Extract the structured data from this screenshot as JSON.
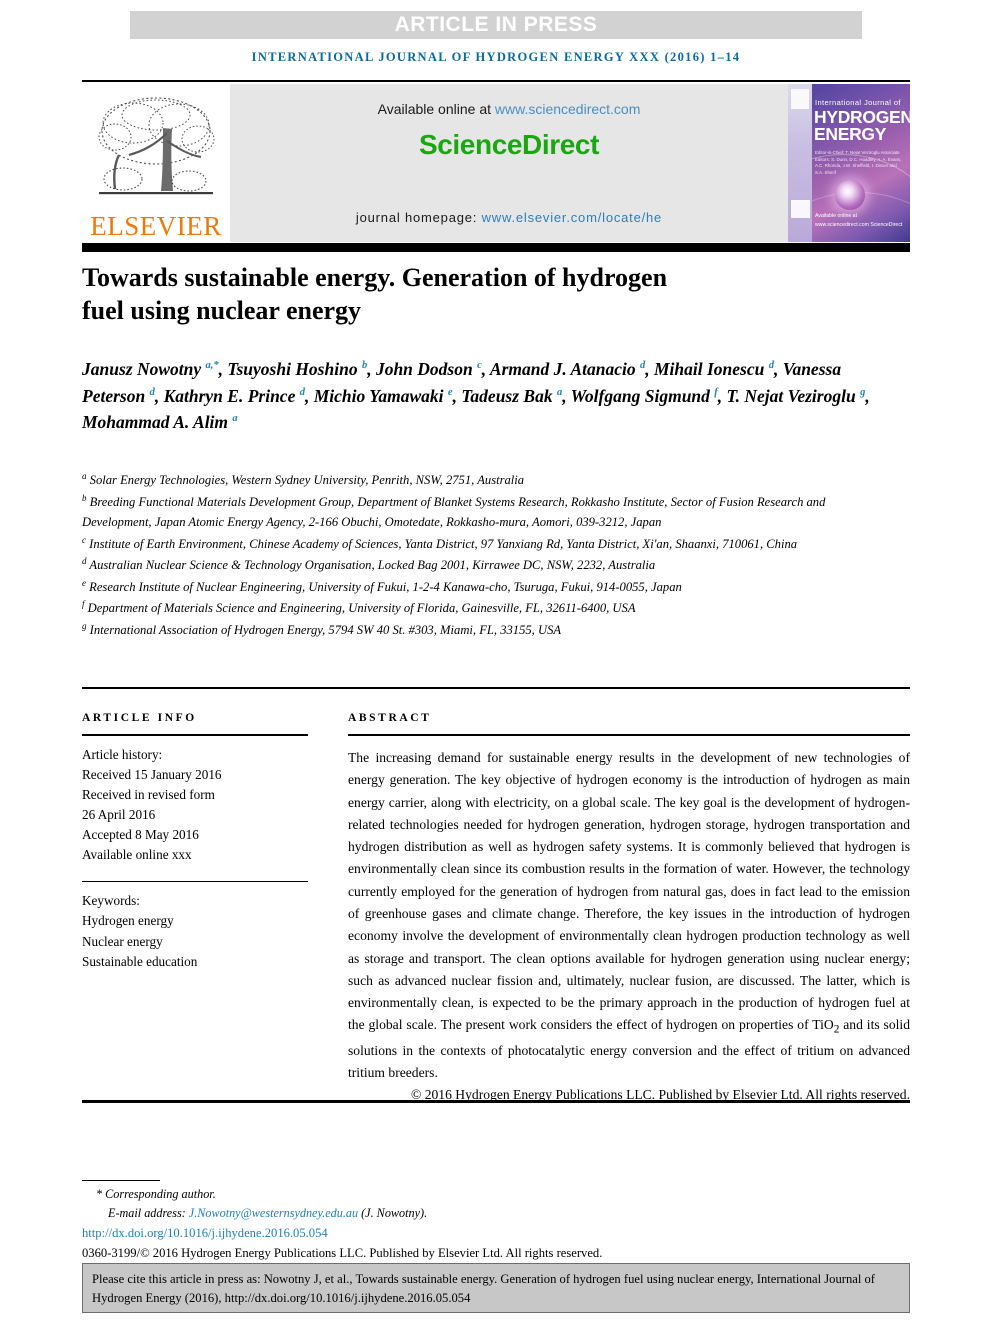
{
  "banner": {
    "text": "ARTICLE IN PRESS"
  },
  "journal_line": "INTERNATIONAL JOURNAL OF HYDROGEN ENERGY XXX (2016) 1–14",
  "masthead": {
    "publisher": "ELSEVIER",
    "available_prefix": "Available online at ",
    "available_link": "www.sciencedirect.com",
    "sciencedirect_logo": "ScienceDirect",
    "homepage_prefix": "journal homepage: ",
    "homepage_link": "www.elsevier.com/locate/he",
    "cover": {
      "small_title": "International Journal of",
      "big_title_1": "HYDROGEN",
      "big_title_2": "ENERGY",
      "editors": "Editor-in-Chief: T. Nejat Veziroglu   Associate Editors: S. Dunn, D.C. Hoadley, A. A. Evans, A.C. Rhonda, J.W. Sheffield, I. Dincer and S.A. Sherif",
      "sciencedirect_mark": "Available online at www.sciencedirect.com  ScienceDirect"
    }
  },
  "article": {
    "title": "Towards sustainable energy. Generation of hydrogen fuel using nuclear energy",
    "authors": [
      {
        "name": "Janusz Nowotny",
        "marks": "a,*"
      },
      {
        "name": "Tsuyoshi Hoshino",
        "marks": "b"
      },
      {
        "name": "John Dodson",
        "marks": "c"
      },
      {
        "name": "Armand J. Atanacio",
        "marks": "d"
      },
      {
        "name": "Mihail Ionescu",
        "marks": "d"
      },
      {
        "name": "Vanessa Peterson",
        "marks": "d"
      },
      {
        "name": "Kathryn E. Prince",
        "marks": "d"
      },
      {
        "name": "Michio Yamawaki",
        "marks": "e"
      },
      {
        "name": "Tadeusz Bak",
        "marks": "a"
      },
      {
        "name": "Wolfgang Sigmund",
        "marks": "f"
      },
      {
        "name": "T. Nejat Veziroglu",
        "marks": "g"
      },
      {
        "name": "Mohammad A. Alim",
        "marks": "a"
      }
    ],
    "affiliations": [
      {
        "mark": "a",
        "text": "Solar Energy Technologies, Western Sydney University, Penrith, NSW, 2751, Australia"
      },
      {
        "mark": "b",
        "text": "Breeding Functional Materials Development Group, Department of Blanket Systems Research, Rokkasho Institute, Sector of Fusion Research and Development, Japan Atomic Energy Agency, 2-166 Obuchi, Omotedate, Rokkasho-mura, Aomori, 039-3212, Japan"
      },
      {
        "mark": "c",
        "text": "Institute of Earth Environment, Chinese Academy of Sciences, Yanta District, 97 Yanxiang Rd, Yanta District, Xi'an, Shaanxi, 710061, China"
      },
      {
        "mark": "d",
        "text": "Australian Nuclear Science & Technology Organisation, Locked Bag 2001, Kirrawee DC, NSW, 2232, Australia"
      },
      {
        "mark": "e",
        "text": "Research Institute of Nuclear Engineering, University of Fukui, 1-2-4 Kanawa-cho, Tsuruga, Fukui, 914-0055, Japan"
      },
      {
        "mark": "f",
        "text": "Department of Materials Science and Engineering, University of Florida, Gainesville, FL, 32611-6400, USA"
      },
      {
        "mark": "g",
        "text": "International Association of Hydrogen Energy, 5794 SW 40 St. #303, Miami, FL, 33155, USA"
      }
    ]
  },
  "article_info": {
    "heading": "ARTICLE INFO",
    "history_label": "Article history:",
    "history": [
      "Received 15 January 2016",
      "Received in revised form",
      "26 April 2016",
      "Accepted 8 May 2016",
      "Available online xxx"
    ],
    "keywords_label": "Keywords:",
    "keywords": [
      "Hydrogen energy",
      "Nuclear energy",
      "Sustainable education"
    ]
  },
  "abstract": {
    "heading": "ABSTRACT",
    "body": "The increasing demand for sustainable energy results in the development of new technologies of energy generation. The key objective of hydrogen economy is the introduction of hydrogen as main energy carrier, along with electricity, on a global scale. The key goal is the development of hydrogen-related technologies needed for hydrogen generation, hydrogen storage, hydrogen transportation and hydrogen distribution as well as hydrogen safety systems. It is commonly believed that hydrogen is environmentally clean since its combustion results in the formation of water. However, the technology currently employed for the generation of hydrogen from natural gas, does in fact lead to the emission of greenhouse gases and climate change. Therefore, the key issues in the introduction of hydrogen economy involve the development of environmentally clean hydrogen production technology as well as storage and transport. The clean options available for hydrogen generation using nuclear energy; such as advanced nuclear fission and, ultimately, nuclear fusion, are discussed. The latter, which is environmentally clean, is expected to be the primary approach in the production of hydrogen fuel at the global scale. The present work considers the effect of hydrogen on properties of TiO2 and its solid solutions in the contexts of photocatalytic energy conversion and the effect of tritium on advanced tritium breeders.",
    "copyright": "© 2016 Hydrogen Energy Publications LLC. Published by Elsevier Ltd. All rights reserved."
  },
  "footer": {
    "corresponding_author": "* Corresponding author.",
    "email_label": "E-mail address: ",
    "email": "J.Nowotny@westernsydney.edu.au",
    "email_suffix": " (J. Nowotny).",
    "doi": "http://dx.doi.org/10.1016/j.ijhydene.2016.05.054",
    "issn_line": "0360-3199/© 2016 Hydrogen Energy Publications LLC. Published by Elsevier Ltd. All rights reserved."
  },
  "cite_box": {
    "text": "Please cite this article in press as: Nowotny J, et al., Towards sustainable energy. Generation of hydrogen fuel using nuclear energy, International Journal of Hydrogen Energy (2016), http://dx.doi.org/10.1016/j.ijhydene.2016.05.054"
  },
  "colors": {
    "link": "#1f7fb5",
    "journal_head": "#0b6a9c",
    "sciencedirect_green": "#1aa811",
    "elsevier_orange": "#ec7a08",
    "banner_gray": "#d2d2d2",
    "cite_gray": "#c7c7c7"
  }
}
